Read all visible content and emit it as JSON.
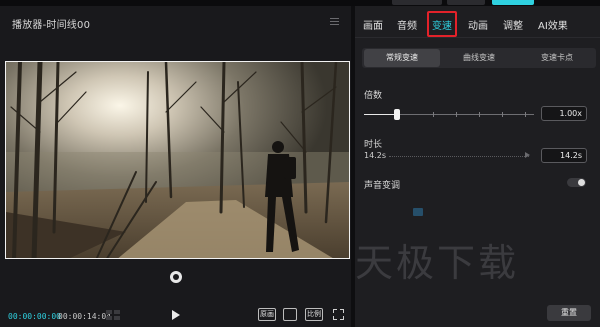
{
  "colors": {
    "accent": "#2fd1e0",
    "highlight": "#e3222a",
    "panel_bg": "#1e1e21",
    "player_bg": "#19191c"
  },
  "player": {
    "title": "播放器-时间线00",
    "menu_icon": "hamburger-icon",
    "time_current": "00:00:00:00",
    "time_total": "00:00:14:04",
    "controls": {
      "original": "原画",
      "crop_icon": "crop-icon",
      "ratio": "比例",
      "fullscreen_icon": "fullscreen-icon"
    }
  },
  "panel": {
    "tabs": [
      {
        "label": "画面"
      },
      {
        "label": "音频"
      },
      {
        "label": "变速"
      },
      {
        "label": "动画"
      },
      {
        "label": "调整"
      },
      {
        "label": "AI效果"
      }
    ],
    "active_tab_index": 2,
    "subtabs": [
      {
        "label": "常规变速"
      },
      {
        "label": "曲线变速"
      },
      {
        "label": "变速卡点"
      }
    ],
    "multiplier": {
      "label": "倍数",
      "value": "1.00x",
      "level": 0.1
    },
    "duration": {
      "label": "时长",
      "from": "14.2s",
      "to": "14.2s"
    },
    "sound_pitch": {
      "label": "声音变调",
      "enabled": false
    },
    "reset_label": "重置"
  },
  "watermark": "天极下载"
}
